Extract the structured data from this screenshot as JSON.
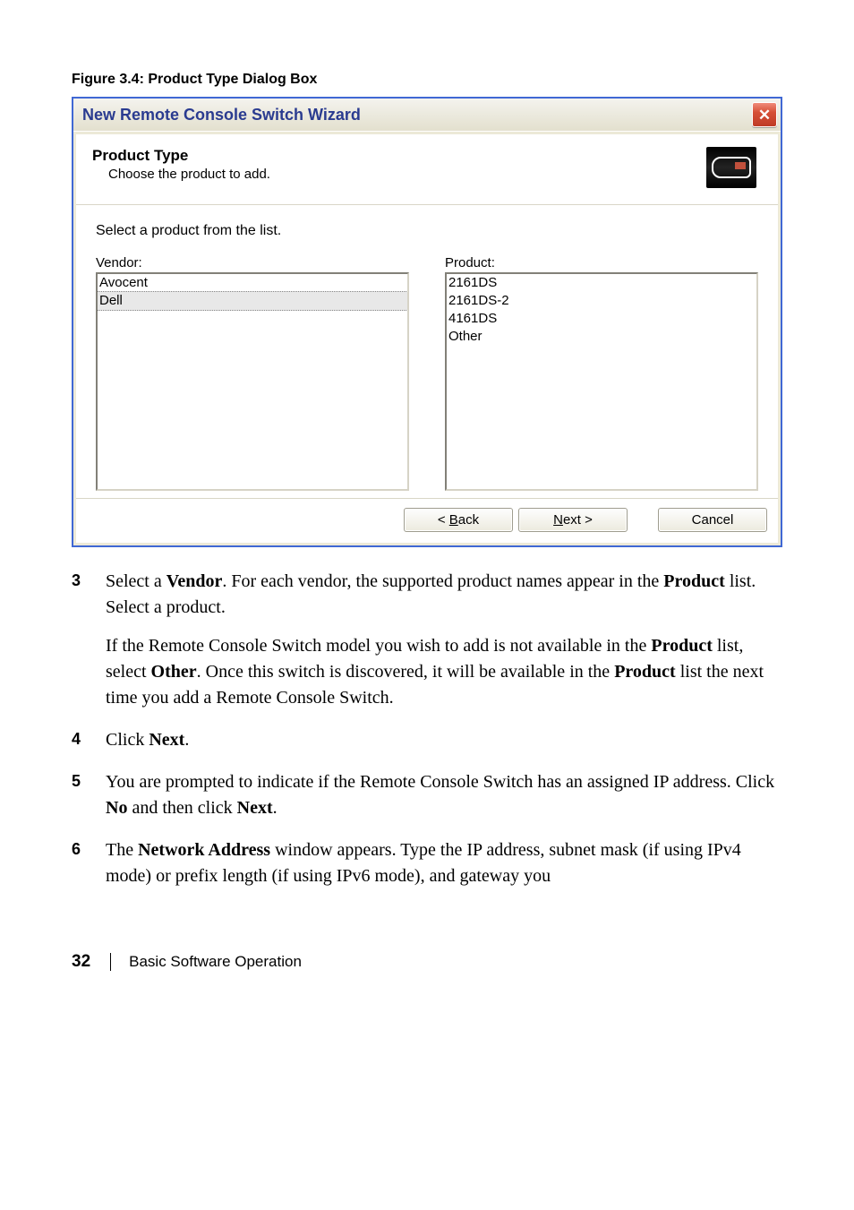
{
  "figure_caption": "Figure 3.4: Product Type Dialog Box",
  "dialog": {
    "title": "New Remote Console Switch Wizard",
    "header_title": "Product Type",
    "header_sub": "Choose the product to add.",
    "instruction": "Select a product from the list.",
    "vendor_label": "Vendor:",
    "product_label": "Product:",
    "vendors": [
      "Avocent",
      "Dell"
    ],
    "vendor_selected_index": 1,
    "products": [
      "2161DS",
      "2161DS-2",
      "4161DS",
      "Other"
    ],
    "buttons": {
      "back_pre": "< ",
      "back_u": "B",
      "back_post": "ack",
      "next_u": "N",
      "next_post": "ext >",
      "cancel": "Cancel"
    }
  },
  "steps": {
    "s3": {
      "num": "3",
      "p1a": "Select a ",
      "p1b": "Vendor",
      "p1c": ". For each vendor, the supported product names appear in the ",
      "p1d": "Product",
      "p1e": " list. Select a product.",
      "p2a": "If the Remote Console Switch model you wish to add is not available in the ",
      "p2b": "Product",
      "p2c": " list, select ",
      "p2d": "Other",
      "p2e": ". Once this switch is discovered, it will be available in the ",
      "p2f": "Product",
      "p2g": " list the next time you add a Remote Console Switch."
    },
    "s4": {
      "num": "4",
      "p1a": "Click ",
      "p1b": "Next",
      "p1c": "."
    },
    "s5": {
      "num": "5",
      "p1a": "You are prompted to indicate if the Remote Console Switch has an assigned IP address. Click ",
      "p1b": "No",
      "p1c": " and then click ",
      "p1d": "Next",
      "p1e": "."
    },
    "s6": {
      "num": "6",
      "p1a": "The ",
      "p1b": "Network Address",
      "p1c": " window appears. Type the IP address, subnet mask (if using IPv4 mode) or prefix length (if using IPv6 mode), and gateway you"
    }
  },
  "footer": {
    "page_number": "32",
    "section": "Basic Software Operation"
  }
}
